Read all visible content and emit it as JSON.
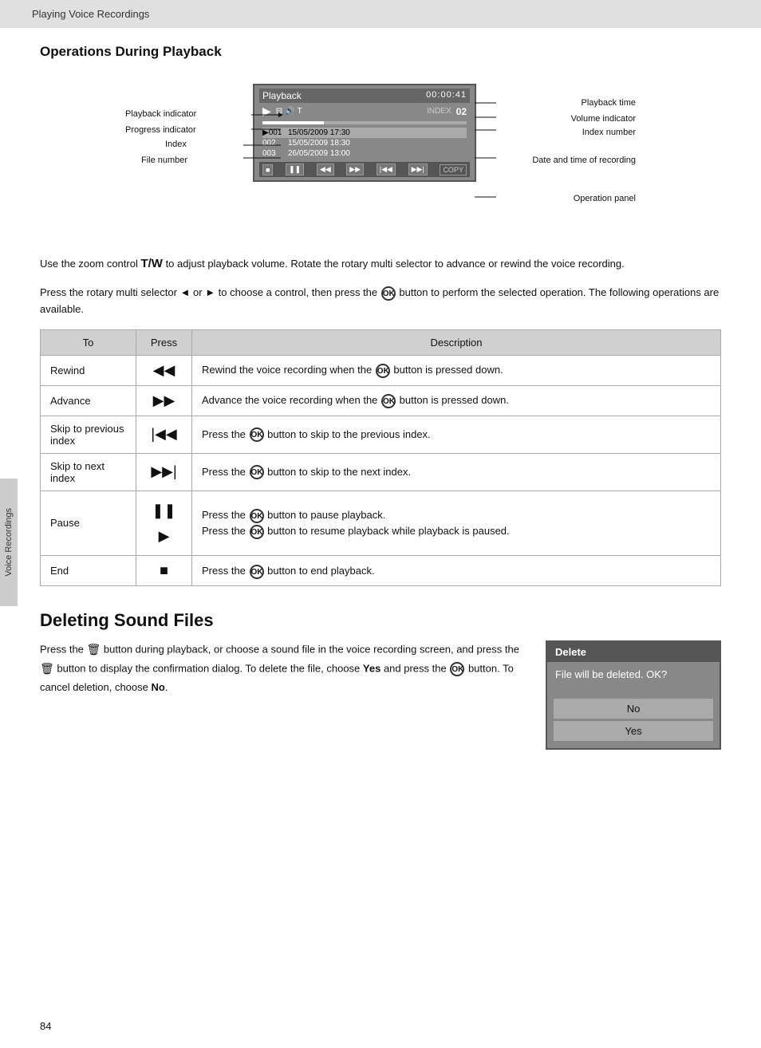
{
  "topBar": {
    "title": "Playing Voice Recordings"
  },
  "section1": {
    "heading": "Operations During Playback",
    "diagram": {
      "screen": {
        "title": "Playback",
        "time": "00:00:41",
        "indexLabel": "INDEX",
        "indexNum": "02",
        "files": [
          {
            "num": "001",
            "date": "15/05/2009 17:30",
            "selected": true
          },
          {
            "num": "002",
            "date": "15/05/2009 18:30",
            "selected": false
          },
          {
            "num": "003",
            "date": "26/05/2009 13:00",
            "selected": false
          }
        ]
      },
      "labels": {
        "playbackIndicator": "Playback indicator",
        "progressIndicator": "Progress indicator",
        "index": "Index",
        "fileNumber": "File number",
        "playbackTime": "Playback time",
        "volumeIndicator": "Volume indicator",
        "indexNumber": "Index number",
        "dateTime": "Date and time of recording",
        "operationPanel": "Operation panel"
      }
    },
    "descText1": "Use the zoom control T/W to adjust playback volume. Rotate the rotary multi selector to advance or rewind the voice recording.",
    "descText2": "Press the rotary multi selector ◄ or ► to choose a control, then press the  button to perform the selected operation. The following operations are available.",
    "table": {
      "headers": [
        "To",
        "Press",
        "Description"
      ],
      "rows": [
        {
          "to": "Rewind",
          "press": "◀◀",
          "desc": "Rewind the voice recording when the  button is pressed down."
        },
        {
          "to": "Advance",
          "press": "▶▶",
          "desc": "Advance the voice recording when the  button is pressed down."
        },
        {
          "to": "Skip to previous index",
          "press": "◀◀|",
          "desc": "Press the  button to skip to the previous index."
        },
        {
          "to": "Skip to next index",
          "press": "|▶▶",
          "desc": "Press the  button to skip to the next index."
        },
        {
          "to": "Pause",
          "press": "❚❚\n▶",
          "desc": "Press the  button to pause playback.\nPress the  button to resume playback while playback is paused."
        },
        {
          "to": "End",
          "press": "■",
          "desc": "Press the  button to end playback."
        }
      ]
    }
  },
  "section2": {
    "heading": "Deleting Sound Files",
    "text": "Press the  button during playback, or choose a sound file in the voice recording screen, and press the  button to display the confirmation dialog. To delete the file, choose Yes and press the  button. To cancel deletion, choose No.",
    "dialog": {
      "header": "Delete",
      "message": "File will be deleted. OK?",
      "buttons": [
        "No",
        "Yes"
      ]
    }
  },
  "sideTab": {
    "label": "Voice Recordings"
  },
  "pageNumber": "84"
}
